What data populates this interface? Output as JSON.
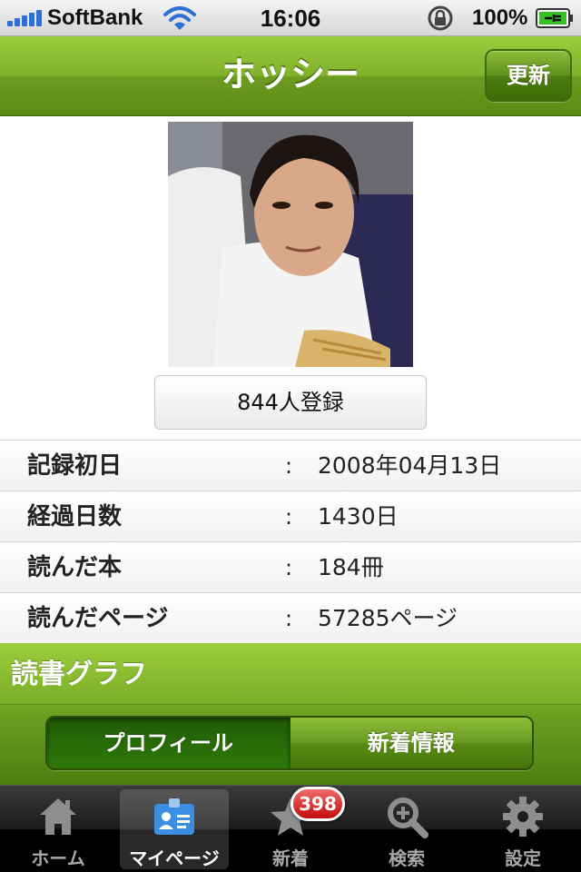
{
  "status_bar": {
    "carrier": "SoftBank",
    "time": "16:06",
    "battery": "100%"
  },
  "nav": {
    "title": "ホッシー",
    "refresh_label": "更新"
  },
  "profile": {
    "register_label": "844人登録"
  },
  "stats": [
    {
      "label": "記録初日",
      "colon": ":",
      "value": "2008年04月13日"
    },
    {
      "label": "経過日数",
      "colon": ":",
      "value": "1430日"
    },
    {
      "label": "読んだ本",
      "colon": ":",
      "value": "184冊"
    },
    {
      "label": "読んだページ",
      "colon": ":",
      "value": "57285ページ"
    }
  ],
  "section": {
    "title": "読書グラフ"
  },
  "segments": {
    "profile": "プロフィール",
    "news": "新着情報",
    "selected": "profile"
  },
  "tabs": [
    {
      "label": "ホーム",
      "icon": "home-icon"
    },
    {
      "label": "マイページ",
      "icon": "mypage-icon"
    },
    {
      "label": "新着",
      "icon": "star-icon",
      "badge": "398"
    },
    {
      "label": "検索",
      "icon": "search-icon"
    },
    {
      "label": "設定",
      "icon": "gear-icon"
    }
  ],
  "selected_tab": "マイページ",
  "colors": {
    "accent_green": "#7fb12b",
    "badge_red": "#d41a1a"
  }
}
